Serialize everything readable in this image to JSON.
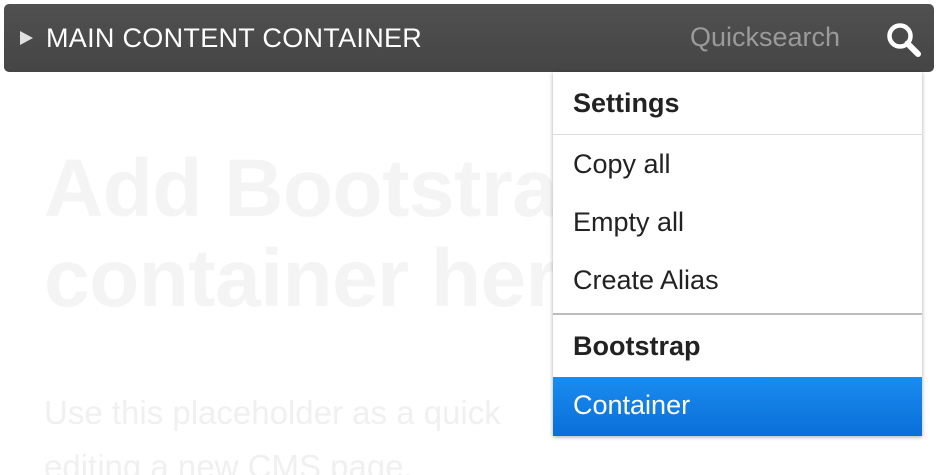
{
  "page": {
    "heading_line1": "Add Bootstrap",
    "heading_line2": "container here",
    "lead_line1": "Use this placeholder as a quick",
    "lead_line2": "editing a new CMS page."
  },
  "placeholder_bar": {
    "title": "MAIN CONTENT CONTAINER",
    "quicksearch_placeholder": "Quicksearch",
    "toggle_icon": "triangle-right-icon",
    "search_icon": "search-icon"
  },
  "dropdown": {
    "settings_header": "Settings",
    "settings_items": [
      "Copy all",
      "Empty all",
      "Create Alias"
    ],
    "bootstrap_header": "Bootstrap",
    "bootstrap_items": [
      "Container"
    ],
    "active_item": "Container"
  },
  "colors": {
    "bar_background": "#4a4a4a",
    "active_item": "#1a8cf0",
    "quicksearch_text": "#9a9a9a"
  }
}
